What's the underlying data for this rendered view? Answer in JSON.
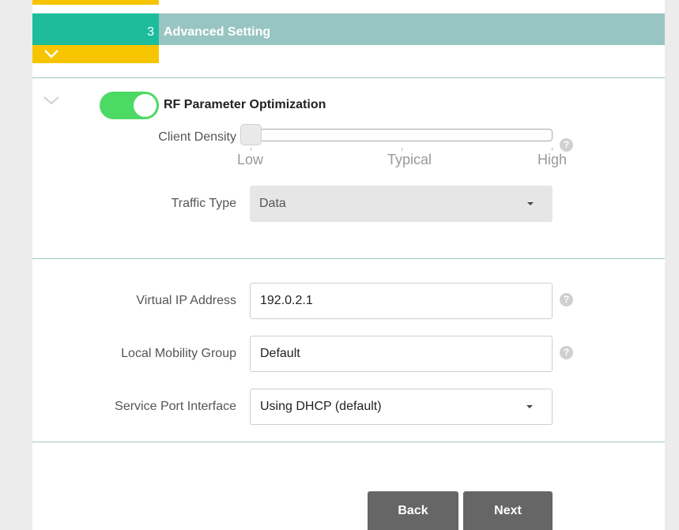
{
  "step": {
    "number": "3",
    "title": "Advanced Setting"
  },
  "rf": {
    "label": "RF Parameter Optimization",
    "enabled": true,
    "client_density": {
      "label": "Client Density",
      "level": 0,
      "ticks": [
        "Low",
        "Typical",
        "High"
      ]
    },
    "traffic_type": {
      "label": "Traffic Type",
      "value": "Data"
    }
  },
  "network": {
    "virtual_ip": {
      "label": "Virtual IP Address",
      "value": "192.0.2.1"
    },
    "mobility_group": {
      "label": "Local Mobility Group",
      "value": "Default"
    },
    "service_port": {
      "label": "Service Port Interface",
      "value": "Using DHCP (default)"
    }
  },
  "help_glyph": "?",
  "buttons": {
    "back": "Back",
    "next": "Next"
  },
  "colors": {
    "accent_green": "#1dbd9c",
    "header_teal": "#98c5c1",
    "tab_yellow": "#f7c500",
    "toggle_on": "#4cd964",
    "button_grey": "#666666"
  },
  "icons": {
    "tab_chevron": "chevron-down-icon",
    "help": "help-circle-icon",
    "dropdown": "caret-down-icon"
  }
}
